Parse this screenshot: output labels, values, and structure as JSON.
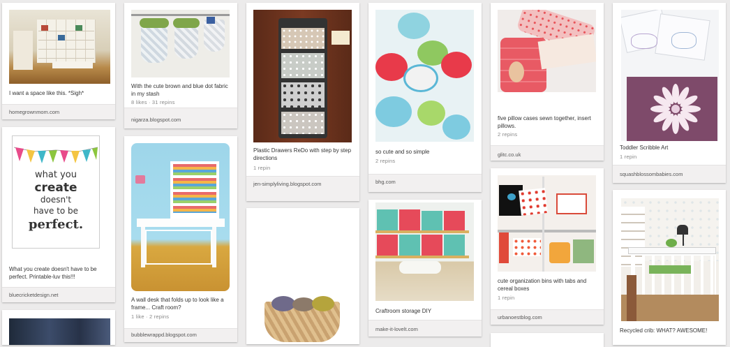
{
  "pins": [
    {
      "id": "p1",
      "description": "I want a space like this. *Sigh*",
      "stats": "",
      "source": "homegrownmom.com"
    },
    {
      "id": "p2",
      "description": "With the cute brown and blue dot fabric in my stash",
      "stats": "8 likes · 31 repins",
      "source": "nigarza.blogspot.com"
    },
    {
      "id": "p3",
      "description": "Plastic Drawers ReDo with step by step directions",
      "stats": "1 repin",
      "source": "jen-simplyliving.blogspot.com"
    },
    {
      "id": "p4",
      "description": "so cute and so simple",
      "stats": "2 repins",
      "source": "bhg.com"
    },
    {
      "id": "p5",
      "description": "five pillow cases sewn together, insert pillows.",
      "stats": "2 repins",
      "source": "glitc.co.uk"
    },
    {
      "id": "p6",
      "description": "Toddler Scribble Art",
      "stats": "1 repin",
      "source": "squashblossombabies.com"
    },
    {
      "id": "p7",
      "description": "What you create doesn't have to be perfect. Printable-luv this!!!",
      "stats": "",
      "source": "bluecricketdesign.net",
      "poster": [
        "what you",
        "create",
        "doesn't",
        "have to be",
        "perfect."
      ]
    },
    {
      "id": "p8",
      "description": "A wall desk that folds up to look like a frame... Craft room?",
      "stats": "1 like · 2 repins",
      "source": "bubblewrappd.blogspot.com"
    },
    {
      "id": "p9",
      "description": "",
      "stats": "",
      "source": ""
    },
    {
      "id": "p10",
      "description": "Craftroom storage DIY",
      "stats": "",
      "source": "make-it-lovelt.com"
    },
    {
      "id": "p11",
      "description": "cute organization bins with tabs and cereal boxes",
      "stats": "1 repin",
      "source": "urbanoestblog.com"
    },
    {
      "id": "p12",
      "description": "Recycled crib: WHAT? AWESOME!",
      "stats": "",
      "source": ""
    },
    {
      "id": "p13",
      "description": "",
      "stats": "",
      "source": ""
    },
    {
      "id": "p14",
      "description": "",
      "stats": "",
      "source": ""
    }
  ],
  "colors": {
    "page_bg": "#ecebeb",
    "card_bg": "#ffffff",
    "source_bar": "#f2f0f0"
  }
}
